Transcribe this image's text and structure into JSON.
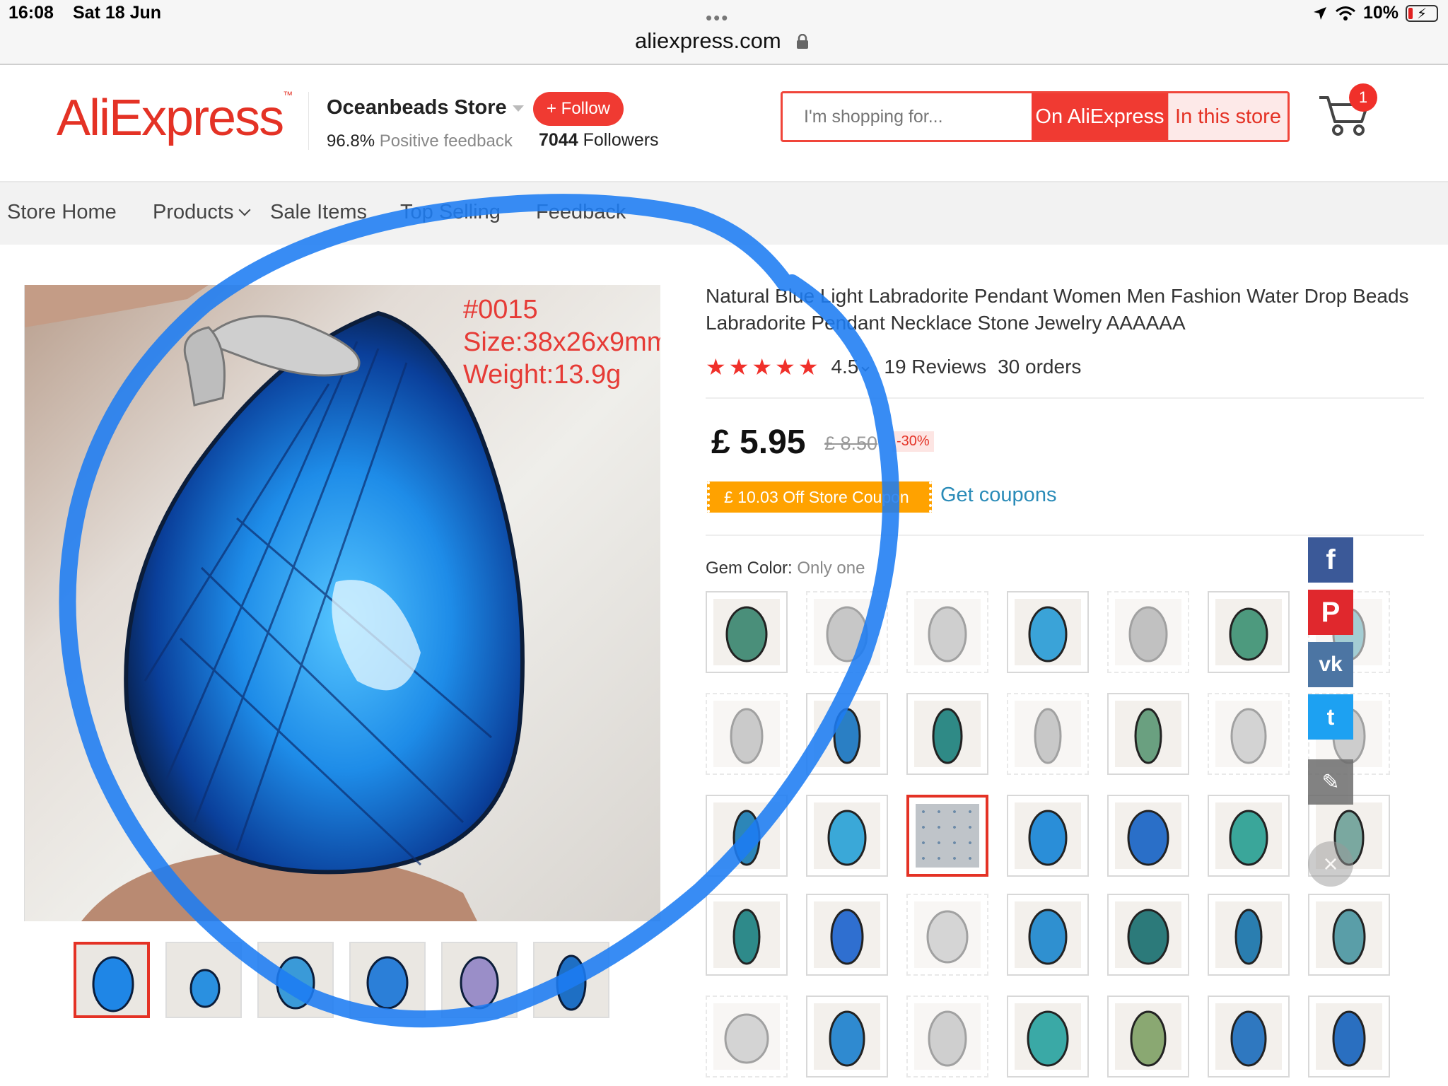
{
  "status_bar": {
    "time": "16:08",
    "date": "Sat 18 Jun",
    "battery": "10%",
    "url": "aliexpress.com",
    "dots": "•••"
  },
  "header": {
    "logo": "AliExpress",
    "logo_tm": "™",
    "store_name": "Oceanbeads Store",
    "follow_label": "+ Follow",
    "feedback_value": "96.8%",
    "feedback_label": "Positive feedback",
    "followers_count": "7044",
    "followers_label": "Followers",
    "search_placeholder": "I'm shopping for...",
    "search_on_aliexpress": "On AliExpress",
    "search_in_store": "In this store",
    "cart_count": "1"
  },
  "nav": {
    "items": [
      "Store Home",
      "Products",
      "Sale Items",
      "Top Selling",
      "Feedback"
    ]
  },
  "product": {
    "image_text": [
      "#0015",
      "Size:38x26x9mm",
      "Weight:13.9g"
    ],
    "title": "Natural Blue Light Labradorite Pendant Women Men Fashion Water Drop Beads Labradorite Pendant Necklace Stone Jewelry AAAAAA",
    "stars": "★★★★★",
    "rating": "4.5",
    "reviews": "19 Reviews",
    "orders": "30 orders",
    "price": "£ 5.95",
    "old_price": "£ 8.50",
    "discount": "-30%",
    "coupon": "£ 10.03 Off Store Coupon",
    "get_coupons": "Get coupons",
    "gem_color_label": "Gem Color:",
    "gem_color_value": "Only one"
  },
  "share": {
    "facebook": "f",
    "pinterest": "P",
    "vk": "vk",
    "twitter": "t",
    "edit": "✎",
    "close": "×"
  },
  "colors": {
    "brand_red": "#e43225",
    "coupon_orange": "#ffa200",
    "annotation_blue": "#1d7cf2"
  }
}
